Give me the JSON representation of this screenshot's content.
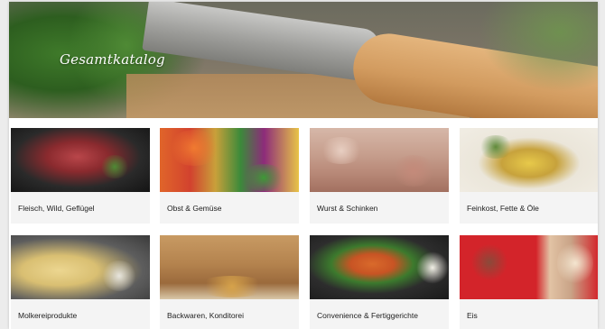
{
  "hero": {
    "title": "Gesamtkatalog"
  },
  "categories": [
    {
      "label": "Fleisch, Wild, Geflügel"
    },
    {
      "label": "Obst & Gemüse"
    },
    {
      "label": "Wurst & Schinken"
    },
    {
      "label": "Feinkost, Fette & Öle"
    },
    {
      "label": "Molkereiprodukte"
    },
    {
      "label": "Backwaren, Konditorei"
    },
    {
      "label": "Convenience & Fertiggerichte"
    },
    {
      "label": "Eis"
    }
  ]
}
